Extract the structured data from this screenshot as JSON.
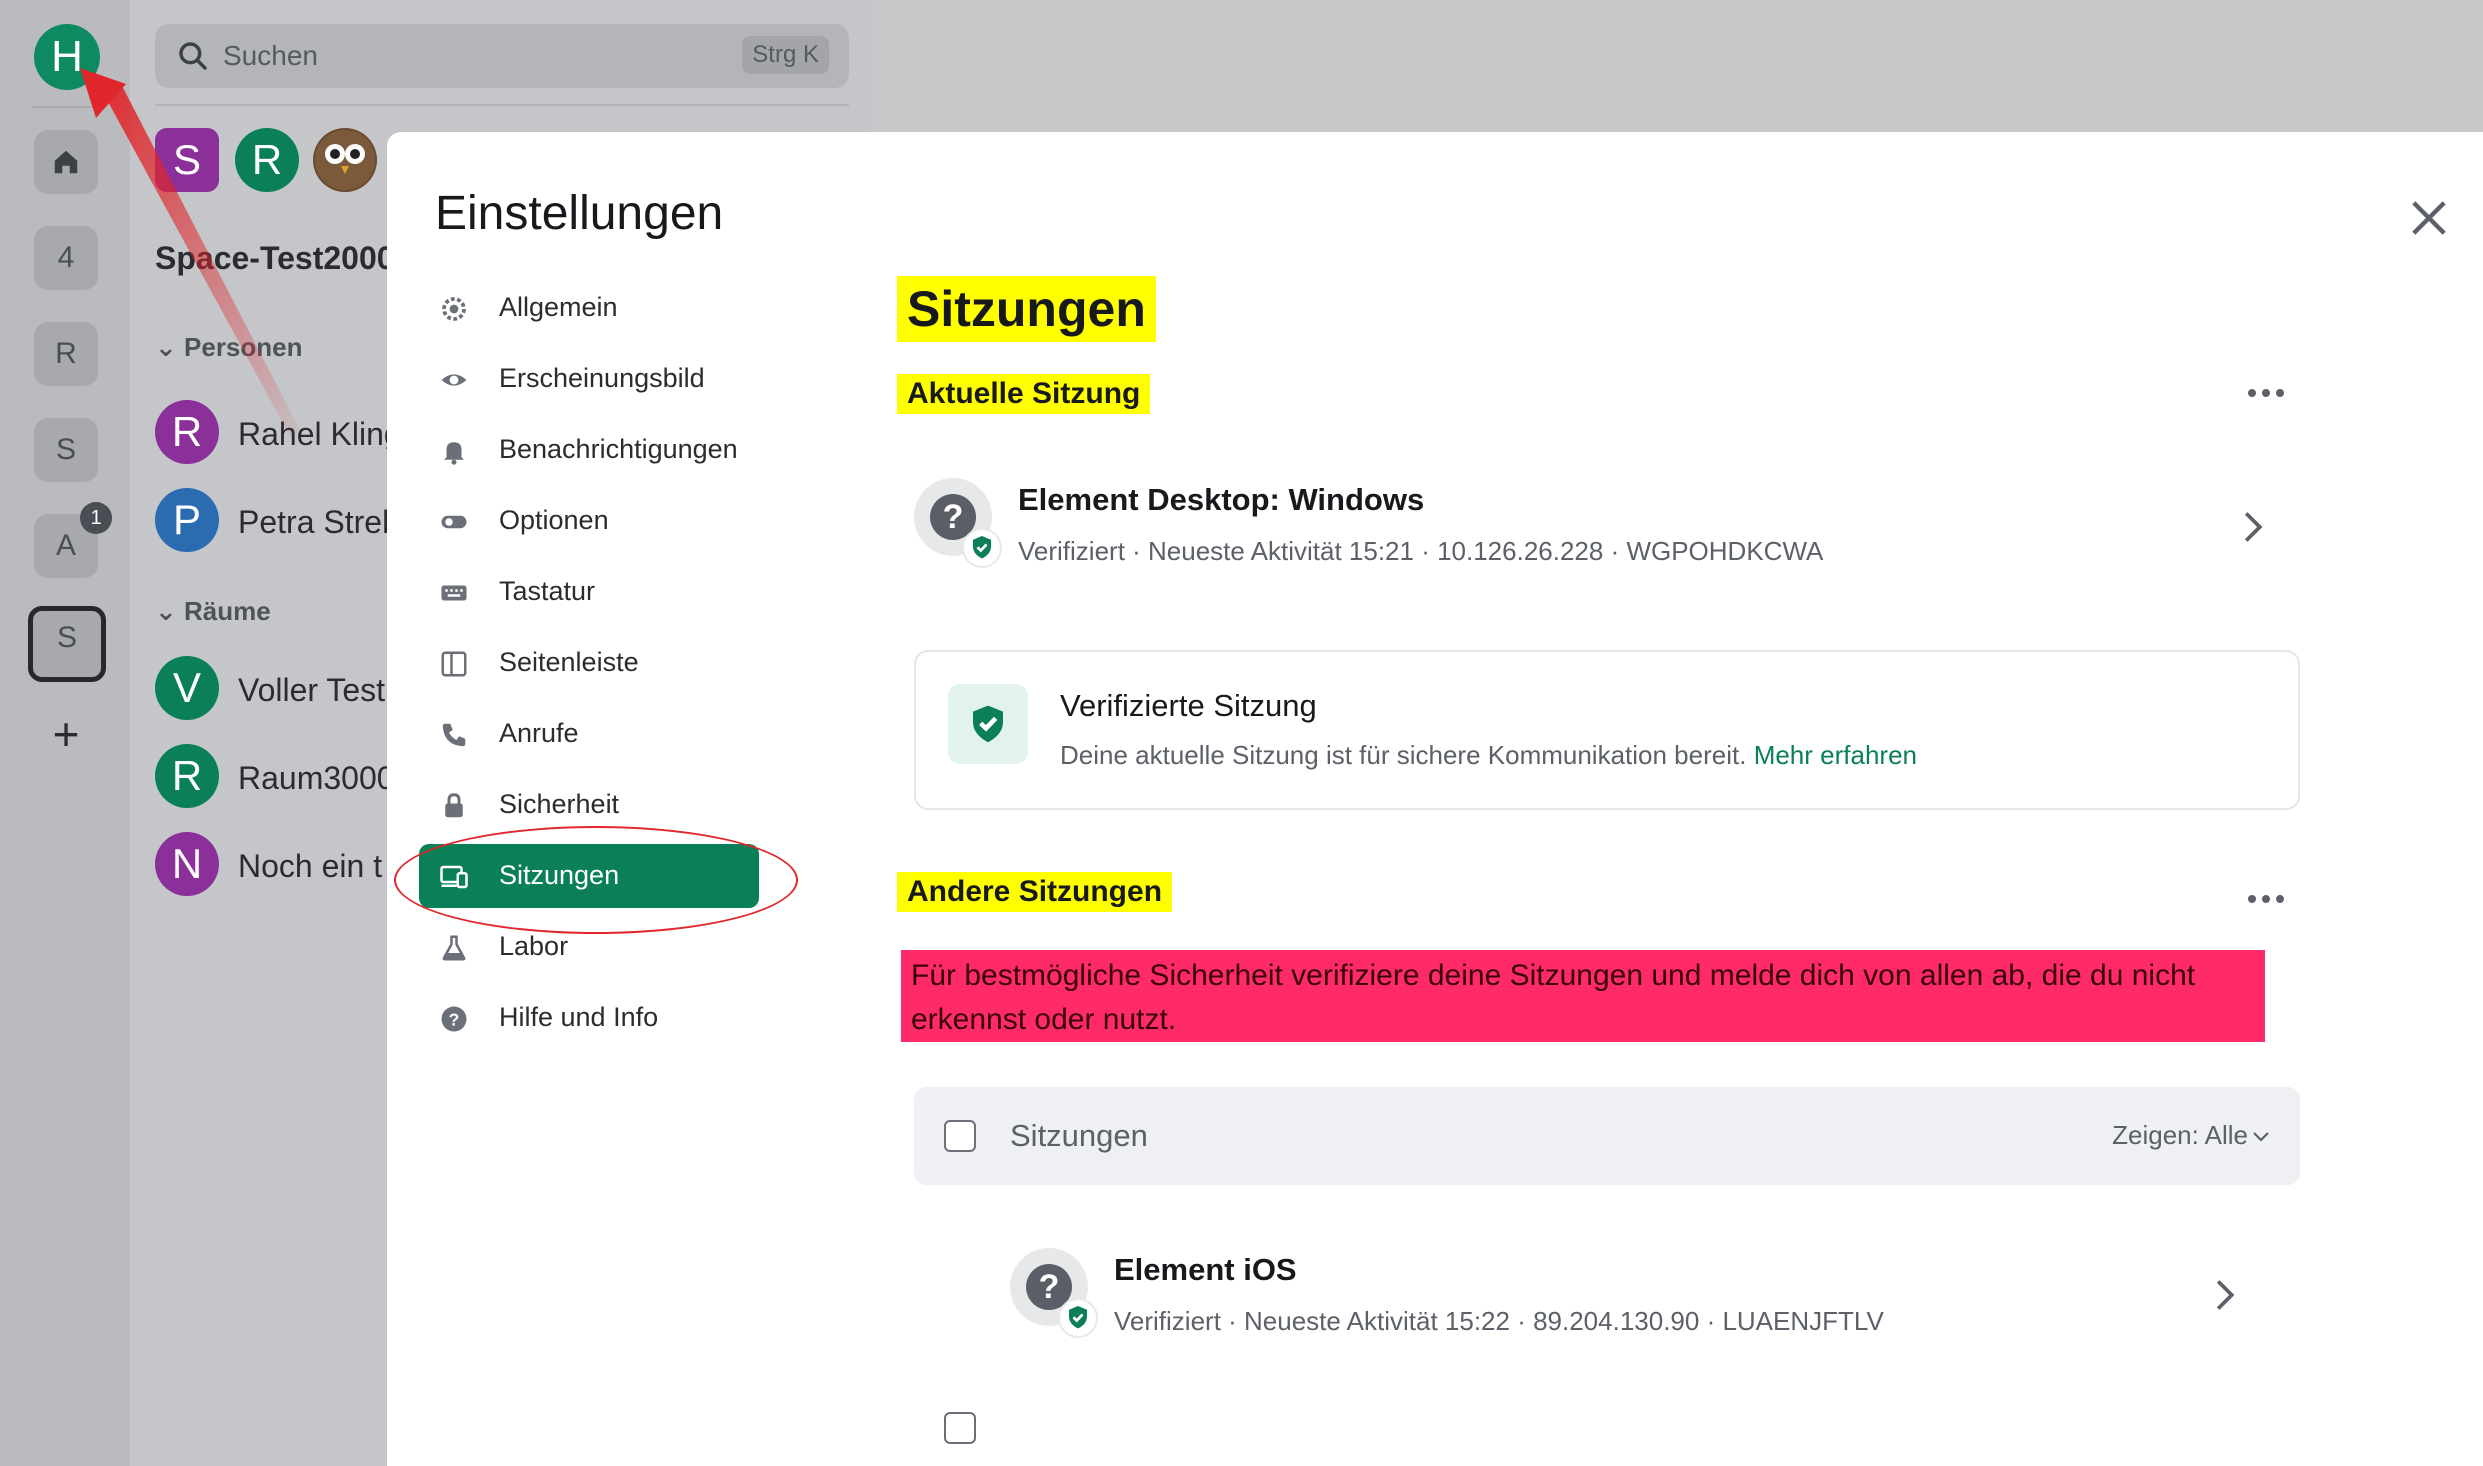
{
  "spacebar": {
    "user_initial": "H",
    "items": [
      {
        "label": "4"
      },
      {
        "label": "R"
      },
      {
        "label": "S"
      },
      {
        "label": "A",
        "badge": "1"
      },
      {
        "label": "S",
        "selected": true
      }
    ],
    "add_label": "+"
  },
  "roomlist": {
    "search_placeholder": "Suchen",
    "search_shortcut": "Strg K",
    "space_title": "Space-Test2000",
    "people_heading": "Personen",
    "rooms_heading": "Räume",
    "top_avatars": [
      {
        "initial": "S",
        "color": "#8b2f99"
      },
      {
        "initial": "R",
        "color": "#0b7f57"
      },
      {
        "initial": "",
        "color": "#6b4a32"
      }
    ],
    "people": [
      {
        "initial": "R",
        "name": "Rahel Kling",
        "color": "#8b2f99"
      },
      {
        "initial": "P",
        "name": "Petra Streb",
        "color": "#2b6cb0"
      }
    ],
    "rooms": [
      {
        "initial": "V",
        "name": "Voller Test",
        "color": "#0b7f57"
      },
      {
        "initial": "R",
        "name": "Raum3000",
        "color": "#0b7f57"
      },
      {
        "initial": "N",
        "name": "Noch ein t",
        "color": "#8b2f99"
      }
    ]
  },
  "settings": {
    "title": "Einstellungen",
    "nav": [
      {
        "label": "Allgemein",
        "icon": "gear-icon"
      },
      {
        "label": "Erscheinungsbild",
        "icon": "eye-icon"
      },
      {
        "label": "Benachrichtigungen",
        "icon": "bell-icon"
      },
      {
        "label": "Optionen",
        "icon": "toggle-icon"
      },
      {
        "label": "Tastatur",
        "icon": "keyboard-icon"
      },
      {
        "label": "Seitenleiste",
        "icon": "sidebar-icon"
      },
      {
        "label": "Anrufe",
        "icon": "phone-icon"
      },
      {
        "label": "Sicherheit",
        "icon": "lock-icon"
      },
      {
        "label": "Sitzungen",
        "icon": "devices-icon",
        "active": true
      },
      {
        "label": "Labor",
        "icon": "flask-icon"
      },
      {
        "label": "Hilfe und Info",
        "icon": "help-icon"
      }
    ]
  },
  "sessions": {
    "heading": "Sitzungen",
    "current_heading": "Aktuelle Sitzung",
    "current": {
      "name": "Element Desktop: Windows",
      "meta": "Verifiziert · Neueste Aktivität 15:21 · 10.126.26.228 · WGPOHDKCWA"
    },
    "verified_card": {
      "title": "Verifizierte Sitzung",
      "desc": "Deine aktuelle Sitzung ist für sichere Kommunikation bereit.",
      "link": "Mehr erfahren"
    },
    "other_heading": "Andere Sitzungen",
    "other_desc": "Für bestmögliche Sicherheit verifiziere deine Sitzungen und melde dich von allen ab, die du nicht erkennst oder nutzt.",
    "filter": {
      "label": "Sitzungen",
      "show": "Zeigen: Alle"
    },
    "others": [
      {
        "name": "Element iOS",
        "meta": "Verifiziert · Neueste Aktivität 15:22 · 89.204.130.90 · LUAENJFTLV"
      }
    ]
  },
  "colors": {
    "accent": "#0b7f57",
    "highlight_yellow": "#ffff00",
    "highlight_pink": "#ff2a68",
    "annotation_red": "#e0262b"
  }
}
